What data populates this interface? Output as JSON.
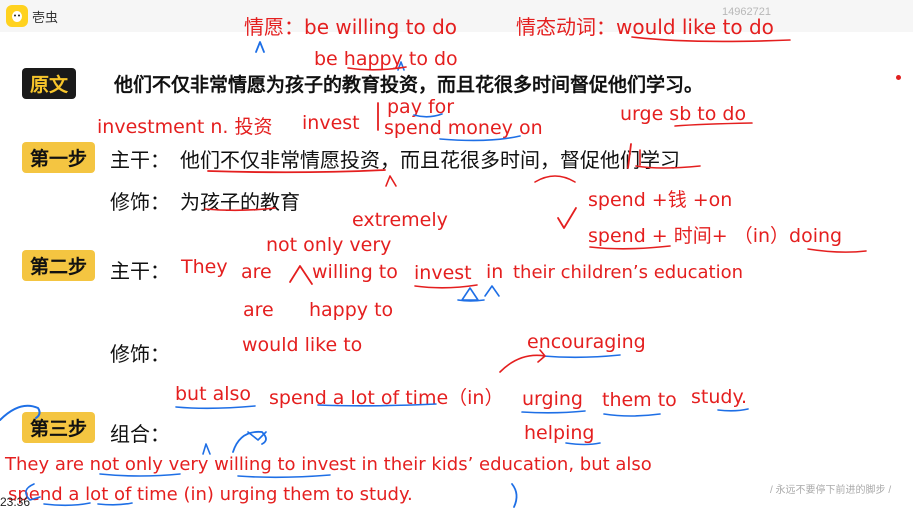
{
  "app": {
    "logo_icon": "egg-logo-icon",
    "name": "壱虫",
    "session_id": "14962721"
  },
  "tags": {
    "original": "原文",
    "step1": "第一步",
    "step2": "第二步",
    "step3": "第三步"
  },
  "original_sentence": "他们不仅非常情愿为孩子的教育投资，而且花很多时间督促他们学习。",
  "step1": {
    "main_label": "主干：",
    "main_text": "他们不仅非常情愿投资，而且花很多时间，督促他们学习",
    "modifier_label": "修饰：",
    "modifier_text": "为孩子的教育"
  },
  "step2": {
    "main_label": "主干：",
    "modifier_label": "修饰："
  },
  "step3": {
    "label": "组合："
  },
  "handwriting": {
    "willing_note": "情愿：be willing to do",
    "modal_note": "情态动词：would like to do",
    "be_happy": "be happy to do",
    "pay_for": "pay for",
    "spend_money_on": "spend money on",
    "investment": "investment n. 投资",
    "invest": "invest",
    "urge": "urge sb to do",
    "spend_money": "spend  +钱 +on",
    "spend_time": "spend + 时间+ （in）doing",
    "extremely": "extremely",
    "not_only_very": "not only very",
    "they": "They",
    "are": "are",
    "willing_to": "willing to",
    "invest_word": "invest",
    "in_word": "in",
    "childrens_education": "their children’s education",
    "are2": "are",
    "happy_to": "happy to",
    "would_like_to": "would like to",
    "encouraging": "encouraging",
    "but_also": "but also",
    "spend_a_lot": "spend a lot of time（in）",
    "urging": "urging",
    "them_to": "them to",
    "study": "study.",
    "helping": "helping",
    "combined_line1": "They are not only very willing to invest in their kids’   education, but also",
    "combined_line2": "spend a lot of time (in)   urging them to study."
  },
  "watermark": "/ 永远不要停下前进的脚步 /",
  "timecode": "23:36",
  "colors": {
    "ink_red": "#e41f1f",
    "ink_blue": "#1e6fe6",
    "tag_yellow": "#f4c541",
    "tag_black": "#1a1a1a"
  }
}
